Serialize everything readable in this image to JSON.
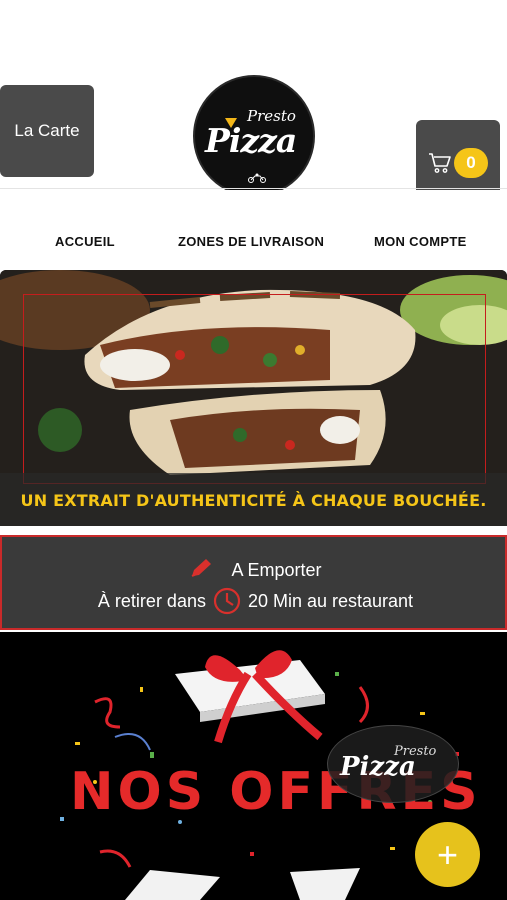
{
  "header": {
    "menu_button_label": "La Carte",
    "logo": {
      "top_word": "Presto",
      "main_word": "Pizza"
    },
    "cart_count": "0"
  },
  "nav": {
    "items": [
      {
        "label": "ACCUEIL"
      },
      {
        "label": "ZONES DE LIVRAISON"
      },
      {
        "label": "MON COMPTE"
      }
    ]
  },
  "hero": {
    "caption": "UN EXTRAIT D'AUTHENTICITÉ À CHAQUE BOUCHÉE."
  },
  "order_info": {
    "mode": "A Emporter",
    "pickup_prefix": "À retirer dans",
    "pickup_time": "20 Min au restaurant"
  },
  "offers": {
    "title": "NOS OFFRES",
    "logo": {
      "top_word": "Presto",
      "main_word": "Pizza"
    }
  },
  "fab": {
    "icon": "plus-icon"
  },
  "colors": {
    "accent_yellow": "#f5c518",
    "accent_red": "#c92a2a",
    "button_grey": "#4a4a4a"
  }
}
